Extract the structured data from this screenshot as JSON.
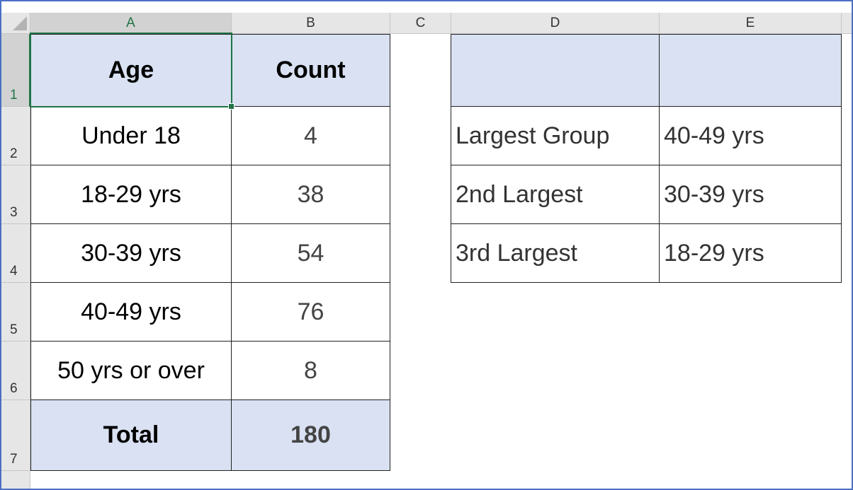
{
  "columns": [
    "A",
    "B",
    "C",
    "D",
    "E"
  ],
  "rows": [
    "1",
    "2",
    "3",
    "4",
    "5",
    "6",
    "7"
  ],
  "age_table": {
    "header": {
      "age": "Age",
      "count": "Count"
    },
    "rows": [
      {
        "age": "Under 18",
        "count": "4"
      },
      {
        "age": "18-29 yrs",
        "count": "38"
      },
      {
        "age": "30-39 yrs",
        "count": "54"
      },
      {
        "age": "40-49 yrs",
        "count": "76"
      },
      {
        "age": "50 yrs or over",
        "count": "8"
      }
    ],
    "total": {
      "label": "Total",
      "value": "180"
    }
  },
  "rank_table": {
    "rows": [
      {
        "label": "Largest Group",
        "value": "40-49 yrs"
      },
      {
        "label": "2nd Largest",
        "value": "30-39 yrs"
      },
      {
        "label": "3rd Largest",
        "value": "18-29 yrs"
      }
    ]
  },
  "selected_cell": "A1",
  "colors": {
    "header_fill": "#d9e1f2",
    "selection": "#217346",
    "frame": "#4a6fc4"
  }
}
